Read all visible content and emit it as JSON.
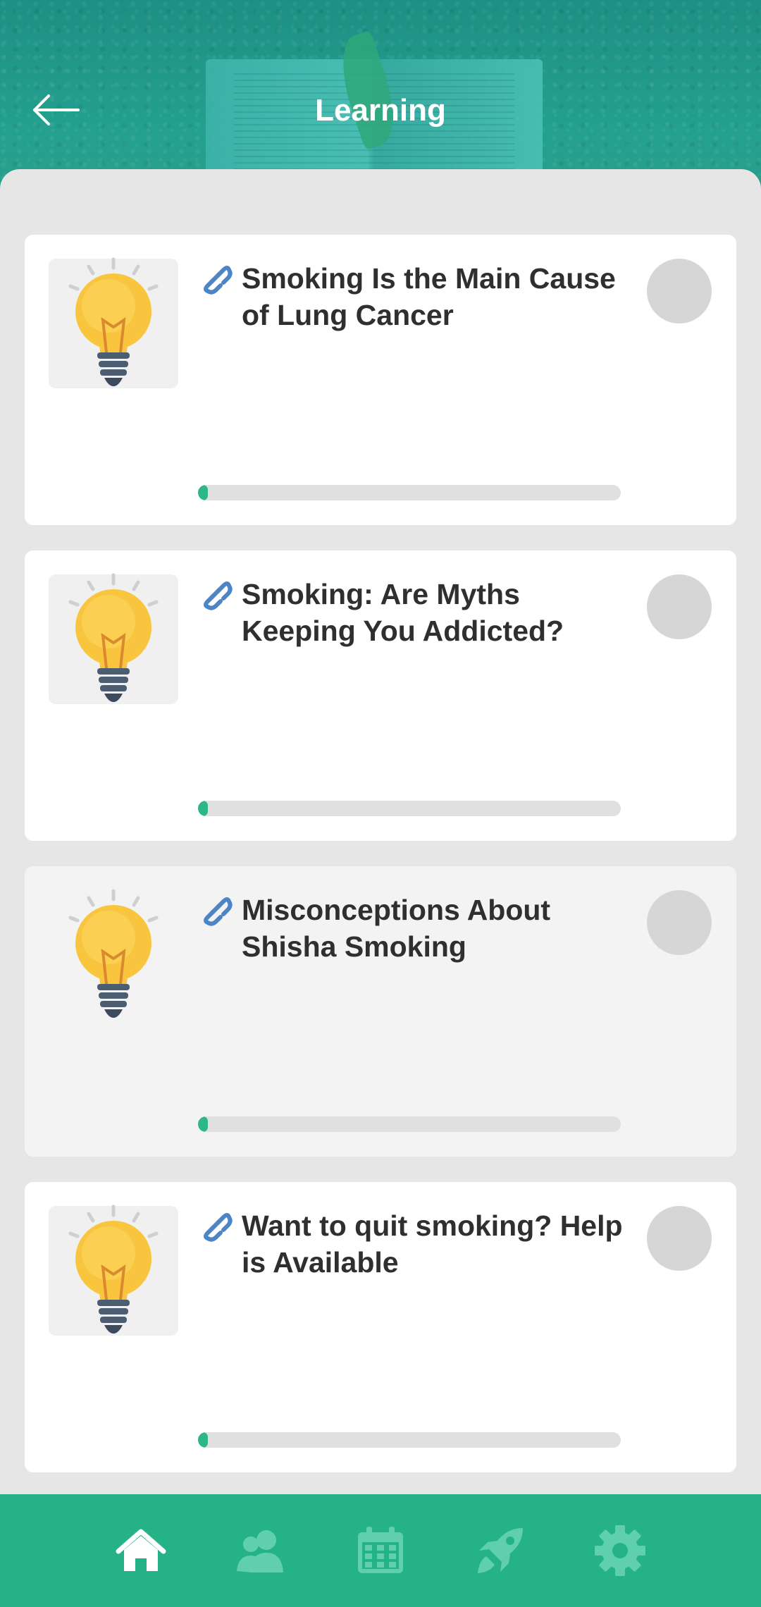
{
  "header": {
    "title": "Learning",
    "back_icon": "arrow-left-icon"
  },
  "cards": [
    {
      "title": "Smoking Is the Main Cause of Lung Cancer",
      "progress": 0.02,
      "icon": "lightbulb-icon",
      "dimmed": false
    },
    {
      "title": "Smoking: Are Myths Keeping You Addicted?",
      "progress": 0.02,
      "icon": "lightbulb-icon",
      "dimmed": false
    },
    {
      "title": "Misconceptions About Shisha Smoking",
      "progress": 0.02,
      "icon": "lightbulb-icon",
      "dimmed": true
    },
    {
      "title": "Want to quit smoking? Help is Available",
      "progress": 0.02,
      "icon": "lightbulb-icon",
      "dimmed": false
    }
  ],
  "bottom_nav": {
    "items": [
      {
        "icon": "home-icon",
        "active": true
      },
      {
        "icon": "people-icon",
        "active": false
      },
      {
        "icon": "calendar-icon",
        "active": false
      },
      {
        "icon": "rocket-icon",
        "active": false
      },
      {
        "icon": "gear-icon",
        "active": false
      }
    ]
  },
  "colors": {
    "accent": "#26b287",
    "progress_fill": "#2bb786",
    "link_icon": "#4a86c6",
    "inactive_nav": "#5fd0ab"
  }
}
